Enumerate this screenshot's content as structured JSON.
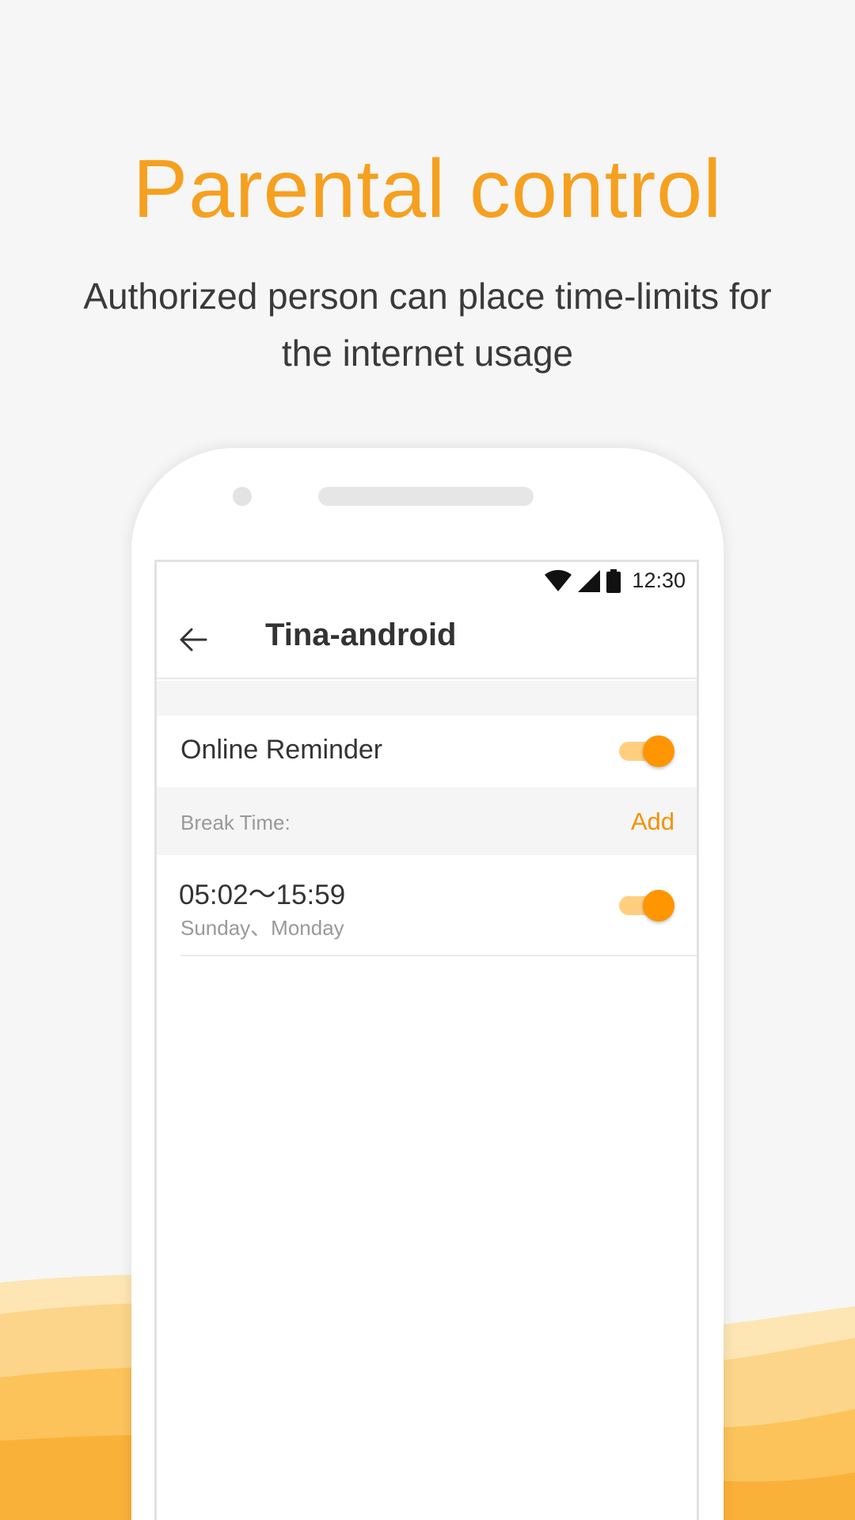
{
  "promo": {
    "headline": "Parental control",
    "subtitle": "Authorized person can place time-limits for the internet usage"
  },
  "status_bar": {
    "time": "12:30",
    "icons": [
      "wifi-icon",
      "cellular-signal-icon",
      "battery-icon"
    ]
  },
  "app_bar": {
    "back_icon": "arrow-left-icon",
    "title": "Tina-android"
  },
  "online_reminder": {
    "label": "Online Reminder",
    "enabled": true
  },
  "break_time": {
    "section_label": "Break Time:",
    "add_label": "Add",
    "items": [
      {
        "time_range": "05:02〜15:59",
        "days": "Sunday、Monday",
        "enabled": true
      }
    ]
  },
  "colors": {
    "accent": "#f39200",
    "headline": "#f6a020",
    "toggle_track": "#ffce7f",
    "toggle_thumb": "#ff9500"
  }
}
